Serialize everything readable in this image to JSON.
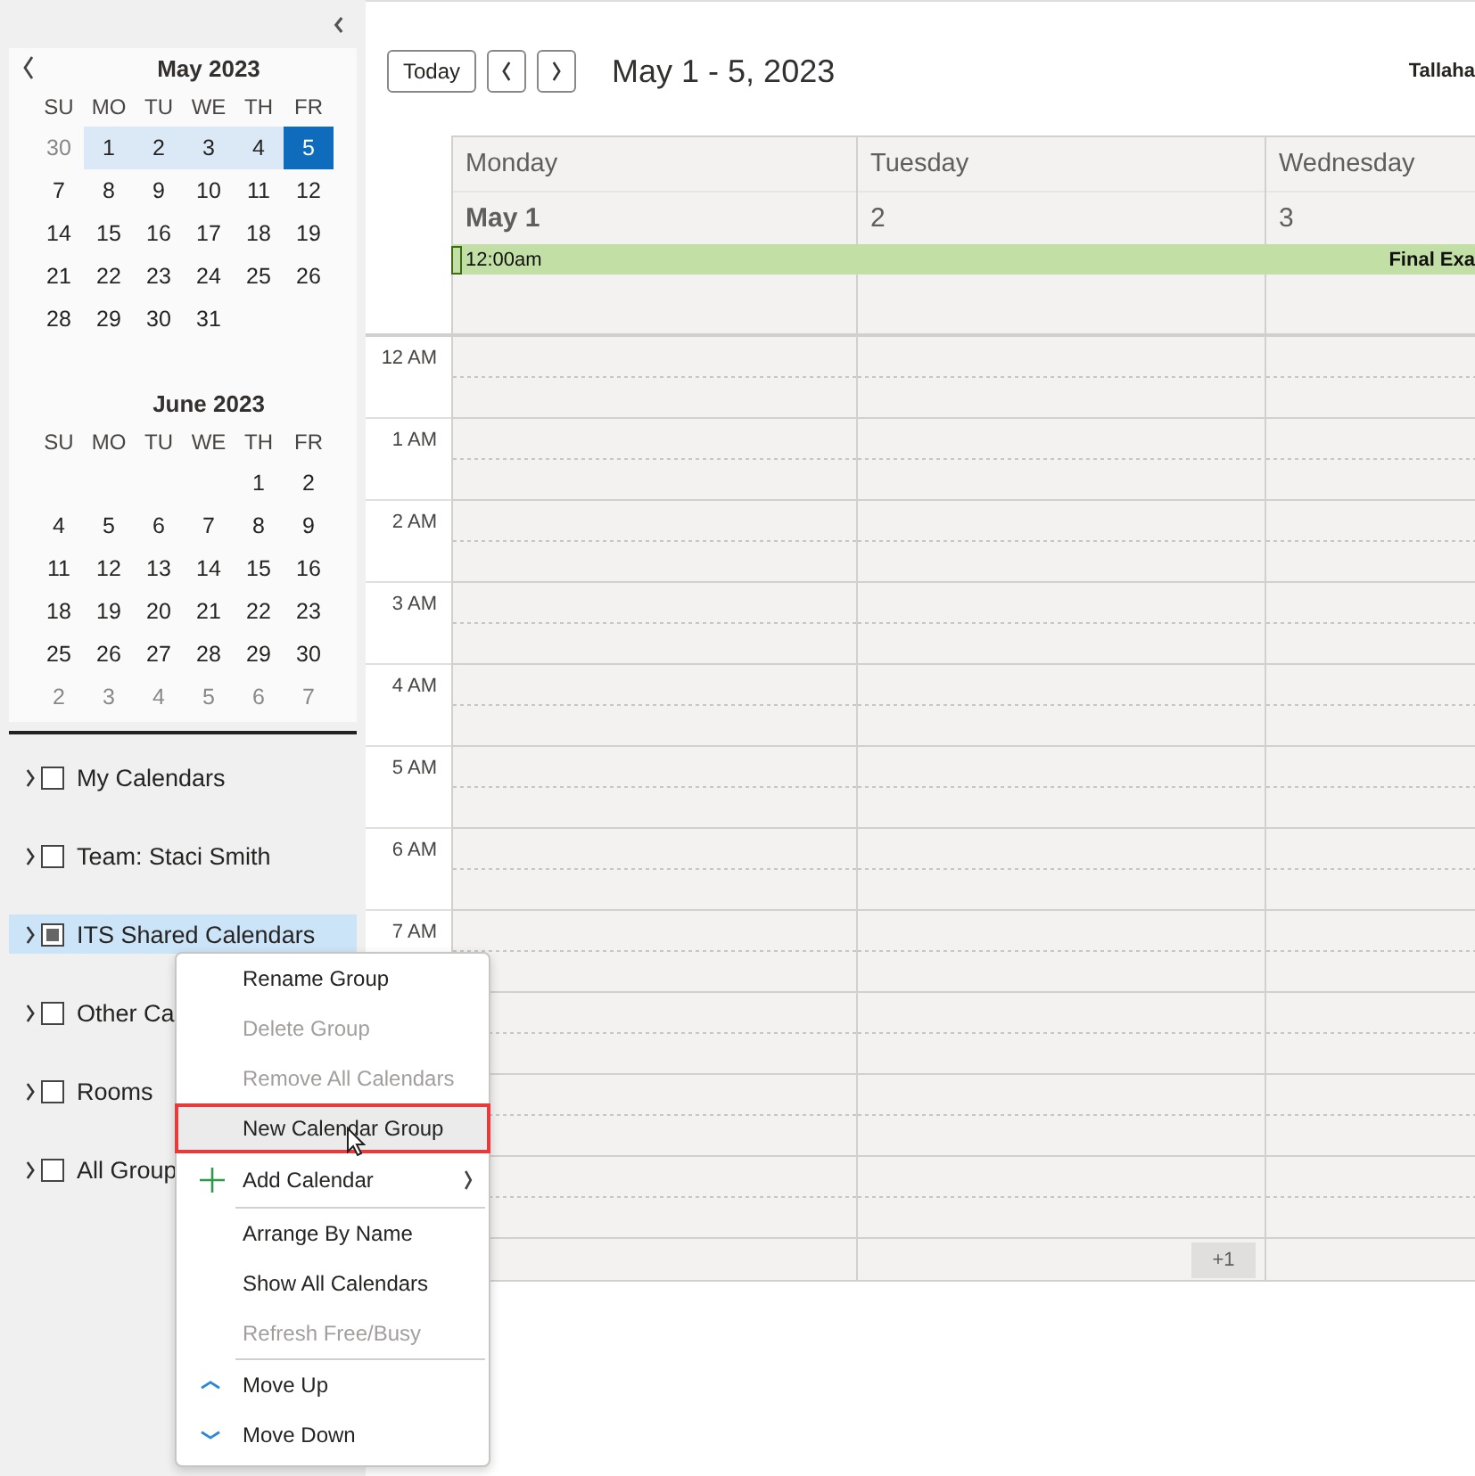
{
  "sidebar": {
    "months": [
      {
        "title": "May 2023",
        "weekdays": [
          "SU",
          "MO",
          "TU",
          "WE",
          "TH",
          "FR"
        ],
        "weeks": [
          {
            "days": [
              {
                "label": "30",
                "muted": true,
                "in_range": false,
                "selected": false
              },
              {
                "label": "1",
                "muted": false,
                "in_range": true,
                "selected": false
              },
              {
                "label": "2",
                "muted": false,
                "in_range": true,
                "selected": false
              },
              {
                "label": "3",
                "muted": false,
                "in_range": true,
                "selected": false
              },
              {
                "label": "4",
                "muted": false,
                "in_range": true,
                "selected": false
              },
              {
                "label": "5",
                "muted": false,
                "in_range": true,
                "selected": true
              }
            ]
          },
          {
            "days": [
              {
                "label": "7",
                "muted": false,
                "in_range": false,
                "selected": false
              },
              {
                "label": "8",
                "muted": false,
                "in_range": false,
                "selected": false
              },
              {
                "label": "9",
                "muted": false,
                "in_range": false,
                "selected": false
              },
              {
                "label": "10",
                "muted": false,
                "in_range": false,
                "selected": false
              },
              {
                "label": "11",
                "muted": false,
                "in_range": false,
                "selected": false
              },
              {
                "label": "12",
                "muted": false,
                "in_range": false,
                "selected": false
              }
            ]
          },
          {
            "days": [
              {
                "label": "14",
                "muted": false,
                "in_range": false,
                "selected": false
              },
              {
                "label": "15",
                "muted": false,
                "in_range": false,
                "selected": false
              },
              {
                "label": "16",
                "muted": false,
                "in_range": false,
                "selected": false
              },
              {
                "label": "17",
                "muted": false,
                "in_range": false,
                "selected": false
              },
              {
                "label": "18",
                "muted": false,
                "in_range": false,
                "selected": false
              },
              {
                "label": "19",
                "muted": false,
                "in_range": false,
                "selected": false
              }
            ]
          },
          {
            "days": [
              {
                "label": "21",
                "muted": false,
                "in_range": false,
                "selected": false
              },
              {
                "label": "22",
                "muted": false,
                "in_range": false,
                "selected": false
              },
              {
                "label": "23",
                "muted": false,
                "in_range": false,
                "selected": false
              },
              {
                "label": "24",
                "muted": false,
                "in_range": false,
                "selected": false
              },
              {
                "label": "25",
                "muted": false,
                "in_range": false,
                "selected": false
              },
              {
                "label": "26",
                "muted": false,
                "in_range": false,
                "selected": false
              }
            ]
          },
          {
            "days": [
              {
                "label": "28",
                "muted": false,
                "in_range": false,
                "selected": false
              },
              {
                "label": "29",
                "muted": false,
                "in_range": false,
                "selected": false
              },
              {
                "label": "30",
                "muted": false,
                "in_range": false,
                "selected": false
              },
              {
                "label": "31",
                "muted": false,
                "in_range": false,
                "selected": false
              }
            ]
          }
        ]
      },
      {
        "title": "June 2023",
        "weekdays": [
          "SU",
          "MO",
          "TU",
          "WE",
          "TH",
          "FR"
        ],
        "weeks": [
          {
            "days": [
              {
                "label": "1",
                "muted": false,
                "in_range": false,
                "selected": false
              },
              {
                "label": "2",
                "muted": false,
                "in_range": false,
                "selected": false
              }
            ]
          },
          {
            "days": [
              {
                "label": "4",
                "muted": false,
                "in_range": false,
                "selected": false
              },
              {
                "label": "5",
                "muted": false,
                "in_range": false,
                "selected": false
              },
              {
                "label": "6",
                "muted": false,
                "in_range": false,
                "selected": false
              },
              {
                "label": "7",
                "muted": false,
                "in_range": false,
                "selected": false
              },
              {
                "label": "8",
                "muted": false,
                "in_range": false,
                "selected": false
              },
              {
                "label": "9",
                "muted": false,
                "in_range": false,
                "selected": false
              }
            ]
          },
          {
            "days": [
              {
                "label": "11",
                "muted": false,
                "in_range": false,
                "selected": false
              },
              {
                "label": "12",
                "muted": false,
                "in_range": false,
                "selected": false
              },
              {
                "label": "13",
                "muted": false,
                "in_range": false,
                "selected": false
              },
              {
                "label": "14",
                "muted": false,
                "in_range": false,
                "selected": false
              },
              {
                "label": "15",
                "muted": false,
                "in_range": false,
                "selected": false
              },
              {
                "label": "16",
                "muted": false,
                "in_range": false,
                "selected": false
              }
            ]
          },
          {
            "days": [
              {
                "label": "18",
                "muted": false,
                "in_range": false,
                "selected": false
              },
              {
                "label": "19",
                "muted": false,
                "in_range": false,
                "selected": false
              },
              {
                "label": "20",
                "muted": false,
                "in_range": false,
                "selected": false
              },
              {
                "label": "21",
                "muted": false,
                "in_range": false,
                "selected": false
              },
              {
                "label": "22",
                "muted": false,
                "in_range": false,
                "selected": false
              },
              {
                "label": "23",
                "muted": false,
                "in_range": false,
                "selected": false
              }
            ]
          },
          {
            "days": [
              {
                "label": "25",
                "muted": false,
                "in_range": false,
                "selected": false
              },
              {
                "label": "26",
                "muted": false,
                "in_range": false,
                "selected": false
              },
              {
                "label": "27",
                "muted": false,
                "in_range": false,
                "selected": false
              },
              {
                "label": "28",
                "muted": false,
                "in_range": false,
                "selected": false
              },
              {
                "label": "29",
                "muted": false,
                "in_range": false,
                "selected": false
              },
              {
                "label": "30",
                "muted": false,
                "in_range": false,
                "selected": false
              }
            ]
          },
          {
            "days": [
              {
                "label": "2",
                "muted": true,
                "in_range": false,
                "selected": false
              },
              {
                "label": "3",
                "muted": true,
                "in_range": false,
                "selected": false
              },
              {
                "label": "4",
                "muted": true,
                "in_range": false,
                "selected": false
              },
              {
                "label": "5",
                "muted": true,
                "in_range": false,
                "selected": false
              },
              {
                "label": "6",
                "muted": true,
                "in_range": false,
                "selected": false
              },
              {
                "label": "7",
                "muted": true,
                "in_range": false,
                "selected": false
              }
            ]
          }
        ]
      }
    ],
    "calendar_groups": [
      {
        "label": "My Calendars",
        "checked": false,
        "indeterminate": false,
        "selected": false
      },
      {
        "label": "Team: Staci Smith",
        "checked": false,
        "indeterminate": false,
        "selected": false
      },
      {
        "label": "ITS Shared Calendars",
        "checked": false,
        "indeterminate": true,
        "selected": true
      },
      {
        "label": "Other Ca",
        "checked": false,
        "indeterminate": false,
        "selected": false
      },
      {
        "label": "Rooms",
        "checked": false,
        "indeterminate": false,
        "selected": false
      },
      {
        "label": "All Group",
        "checked": false,
        "indeterminate": false,
        "selected": false
      }
    ]
  },
  "toolbar": {
    "today_button": "Today",
    "title": "May 1 - 5, 2023",
    "location": "Tallaha"
  },
  "week_view": {
    "days": [
      {
        "name": "Monday",
        "date": "May 1",
        "month_start": true
      },
      {
        "name": "Tuesday",
        "date": "2",
        "month_start": false
      },
      {
        "name": "Wednesday",
        "date": "3",
        "month_start": false
      }
    ],
    "all_day_event": {
      "time": "12:00am",
      "title": "Final Exa"
    },
    "hours": [
      "12 AM",
      "1 AM",
      "2 AM",
      "3 AM",
      "4 AM",
      "5 AM",
      "6 AM",
      "7 AM"
    ],
    "more_badge": "+1"
  },
  "context_menu": [
    {
      "kind": "item",
      "label": "Rename Group",
      "disabled": false,
      "selected": false
    },
    {
      "kind": "item",
      "label": "Delete Group",
      "disabled": true,
      "selected": false
    },
    {
      "kind": "item",
      "label": "Remove All Calendars",
      "disabled": true,
      "selected": false
    },
    {
      "kind": "item",
      "label": "New Calendar Group",
      "disabled": false,
      "selected": true
    },
    {
      "kind": "add",
      "label": "Add Calendar",
      "disabled": false,
      "selected": false,
      "submenu": true
    },
    {
      "kind": "separator"
    },
    {
      "kind": "item",
      "label": "Arrange By Name",
      "disabled": false,
      "selected": false
    },
    {
      "kind": "item",
      "label": "Show All Calendars",
      "disabled": false,
      "selected": false
    },
    {
      "kind": "item",
      "label": "Refresh Free/Busy",
      "disabled": true,
      "selected": false
    },
    {
      "kind": "separator"
    },
    {
      "kind": "up",
      "label": "Move Up",
      "disabled": false,
      "selected": false
    },
    {
      "kind": "down",
      "label": "Move Down",
      "disabled": false,
      "selected": false
    }
  ]
}
